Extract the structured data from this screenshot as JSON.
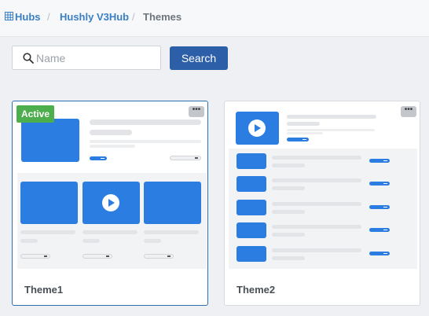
{
  "breadcrumb": {
    "hubs_label": "Hubs",
    "hub_label": "Hushly V3Hub",
    "current_label": "Themes",
    "separator": "/"
  },
  "search": {
    "placeholder": "Name",
    "value": "",
    "button_label": "Search"
  },
  "themes": [
    {
      "name": "Theme1",
      "badge": "Active",
      "more": "•••"
    },
    {
      "name": "Theme2",
      "more": "•••"
    }
  ],
  "colors": {
    "accent": "#2d5fa9",
    "link": "#3a7fc4",
    "active_badge": "#4cae4c",
    "preview_blue": "#2b7de1"
  }
}
